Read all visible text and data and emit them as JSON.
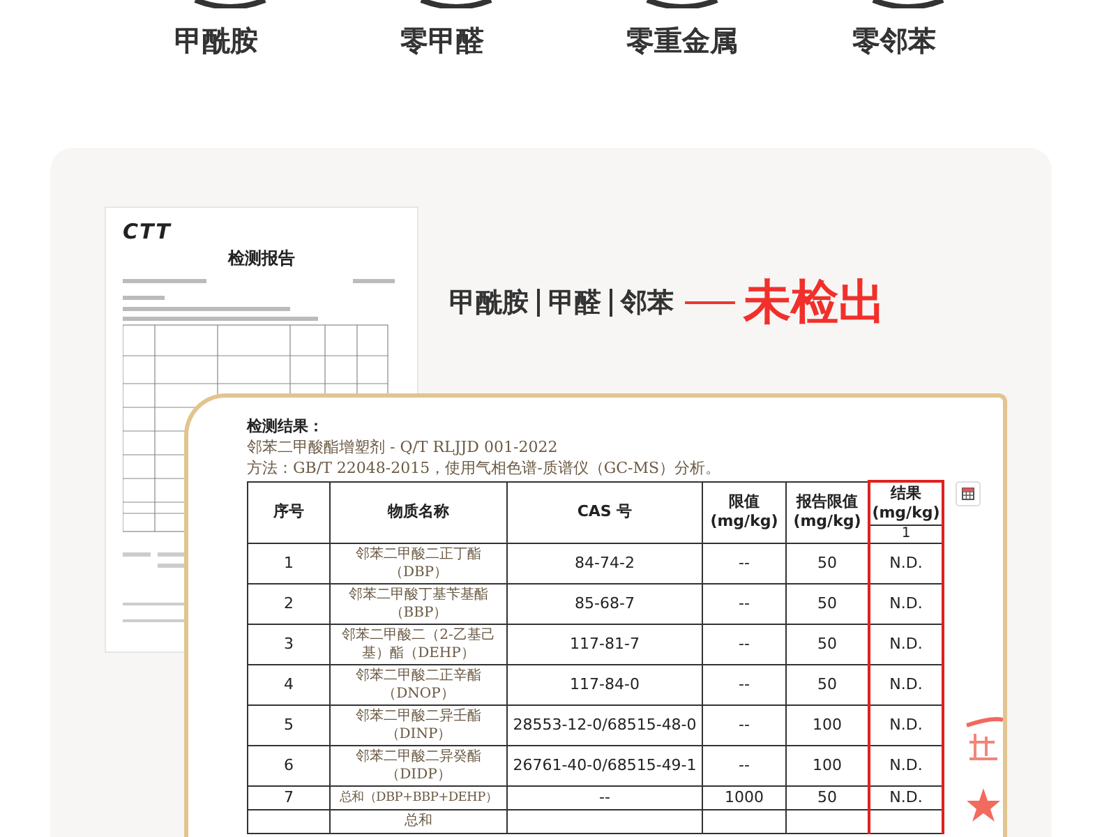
{
  "features": [
    {
      "label": "甲酰胺"
    },
    {
      "label": "零甲醛"
    },
    {
      "label": "零重金属"
    },
    {
      "label": "零邻苯"
    }
  ],
  "report_thumbnail": {
    "logo": "CTT",
    "title": "检测报告"
  },
  "headline": {
    "items": [
      "甲酰胺",
      "甲醛",
      "邻苯"
    ],
    "result": "未检出"
  },
  "report": {
    "heading": "检测结果：",
    "standard": "邻苯二甲酸酯增塑剂 - Q/T RLJJD 001-2022",
    "method": "方法：GB/T 22048-2015，使用气相色谱-质谱仪（GC-MS）分析。",
    "columns": [
      "序号",
      "物质名称",
      "CAS 号",
      "限值\n(mg/kg)",
      "报告限值\n(mg/kg)",
      "结果\n(mg/kg)"
    ],
    "result_sub": "1",
    "rows": [
      {
        "no": "1",
        "name": "邻苯二甲酸二正丁酯（DBP）",
        "cas": "84-74-2",
        "limit": "--",
        "report_limit": "50",
        "result": "N.D."
      },
      {
        "no": "2",
        "name": "邻苯二甲酸丁基苄基酯（BBP）",
        "cas": "85-68-7",
        "limit": "--",
        "report_limit": "50",
        "result": "N.D."
      },
      {
        "no": "3",
        "name": "邻苯二甲酸二（2-乙基己基）酯（DEHP）",
        "cas": "117-81-7",
        "limit": "--",
        "report_limit": "50",
        "result": "N.D."
      },
      {
        "no": "4",
        "name": "邻苯二甲酸二正辛酯（DNOP）",
        "cas": "117-84-0",
        "limit": "--",
        "report_limit": "50",
        "result": "N.D."
      },
      {
        "no": "5",
        "name": "邻苯二甲酸二异壬酯（DINP）",
        "cas": "28553-12-0/68515-48-0",
        "limit": "--",
        "report_limit": "100",
        "result": "N.D."
      },
      {
        "no": "6",
        "name": "邻苯二甲酸二异癸酯（DIDP）",
        "cas": "26761-40-0/68515-49-1",
        "limit": "--",
        "report_limit": "100",
        "result": "N.D."
      },
      {
        "no": "7",
        "name": "总和（DBP+BBP+DEHP）",
        "cas": "--",
        "limit": "1000",
        "report_limit": "50",
        "result": "N.D."
      },
      {
        "name": "总和"
      }
    ]
  }
}
